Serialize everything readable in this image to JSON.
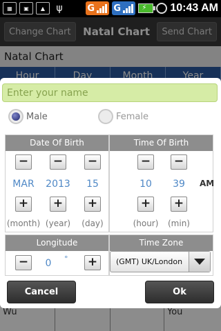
{
  "status_bar": {
    "time": "10:43 AM",
    "icons": [
      "keyboard-icon",
      "screen-icon",
      "image-icon",
      "usb-icon"
    ],
    "signal1": "G",
    "signal2": "G",
    "battery_glyph": "⚡"
  },
  "app": {
    "toolbar": {
      "change_chart": "Change Chart",
      "title": "Natal Chart",
      "send_chart": "Send Chart"
    },
    "subtitle": "Natal Chart",
    "columns": [
      "Hour",
      "Day",
      "Month",
      "Year"
    ],
    "bottom_row": [
      "Wu",
      "You"
    ]
  },
  "dialog": {
    "name_placeholder": "Enter your name",
    "gender": {
      "male": "Male",
      "female": "Female",
      "selected": "male"
    },
    "date_of_birth": {
      "title": "Date Of Birth",
      "month": "MAR",
      "year": "2013",
      "day": "15",
      "month_label": "(month)",
      "year_label": "(year)",
      "day_label": "(day)"
    },
    "time_of_birth": {
      "title": "Time Of Birth",
      "hour": "10",
      "minute": "39",
      "ampm": "AM",
      "hour_label": "(hour)",
      "minute_label": "(min)"
    },
    "longitude": {
      "title": "Longitude",
      "value": "0",
      "unit": "°"
    },
    "time_zone": {
      "title": "Time Zone",
      "selected": "(GMT) UK/London"
    },
    "cancel_label": "Cancel",
    "ok_label": "Ok",
    "step_minus": "−",
    "step_plus": "+"
  },
  "colors": {
    "accent_value": "#4f88c6",
    "input_bg": "#d6eca6",
    "panel_header": "#8d8d8d",
    "button_dark": "#333333"
  }
}
